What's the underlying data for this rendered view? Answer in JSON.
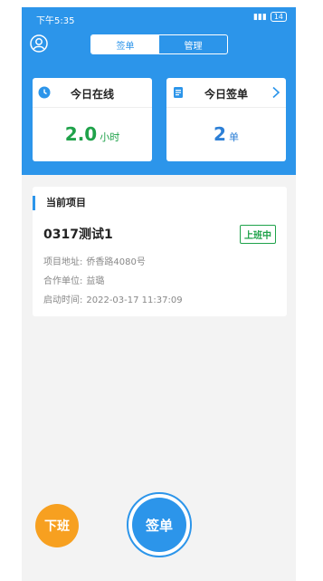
{
  "status_bar": {
    "time": "下午5:35",
    "battery": "14"
  },
  "segmented": {
    "tabs": [
      "签单",
      "管理"
    ]
  },
  "cards": {
    "online": {
      "title": "今日在线",
      "value": "2.0",
      "unit": "小时"
    },
    "signs": {
      "title": "今日签单",
      "value": "2",
      "unit": "单"
    }
  },
  "project": {
    "section_title": "当前项目",
    "name": "0317测试1",
    "status": "上班中",
    "address_label": "项目地址:",
    "address": "侨香路4080号",
    "partner_label": "合作单位:",
    "partner": "益璐",
    "start_label": "启动时间:",
    "start_time": "2022-03-17 11:37:09"
  },
  "actions": {
    "off_duty": "下班",
    "sign": "签单"
  },
  "colors": {
    "primary": "#2c95ea",
    "success": "#1fa24a",
    "warning": "#f7a020"
  },
  "icons": [
    "avatar-icon",
    "clock-icon",
    "document-icon",
    "chevron-right-icon",
    "signal-icon",
    "battery-icon"
  ]
}
